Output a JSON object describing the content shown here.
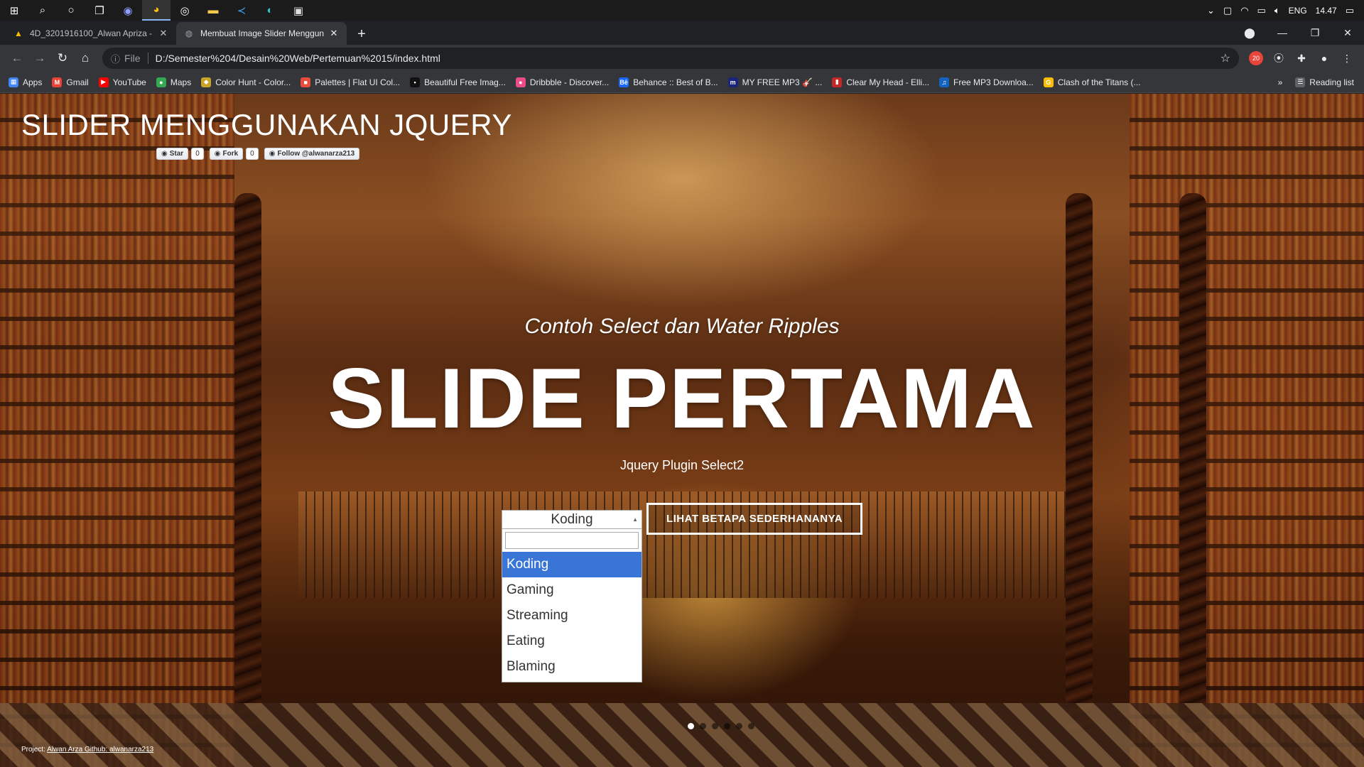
{
  "taskbar": {
    "icons": [
      "windows-icon",
      "search-icon",
      "cortana-icon",
      "task-view-icon",
      "discord-icon",
      "chrome-icon",
      "github-desktop-icon",
      "file-explorer-icon",
      "vscode-icon",
      "edge-icon",
      "photos-icon"
    ],
    "language": "ENG",
    "time": "14.47"
  },
  "tabs": [
    {
      "title": "4D_3201916100_Alwan Apriza - G",
      "icon": "google-drive-icon",
      "active": false
    },
    {
      "title": "Membuat Image Slider Menggun",
      "icon": "globe-icon",
      "active": true
    }
  ],
  "toolbar": {
    "scheme": "File",
    "url": "D:/Semester%204/Desain%20Web/Pertemuan%2015/index.html",
    "ext_badge": "20"
  },
  "bookmarks": [
    {
      "label": "Apps",
      "color": "#4285f4",
      "glyph": "▦"
    },
    {
      "label": "Gmail",
      "color": "#ea4335",
      "glyph": "M"
    },
    {
      "label": "YouTube",
      "color": "#ff0000",
      "glyph": "▶"
    },
    {
      "label": "Maps",
      "color": "#34a853",
      "glyph": "●"
    },
    {
      "label": "Color Hunt - Color...",
      "color": "#c9a227",
      "glyph": "◆"
    },
    {
      "label": "Palettes | Flat UI Col...",
      "color": "#e74c3c",
      "glyph": "■"
    },
    {
      "label": "Beautiful Free Imag...",
      "color": "#111111",
      "glyph": "▪"
    },
    {
      "label": "Dribbble - Discover...",
      "color": "#ea4c89",
      "glyph": "●"
    },
    {
      "label": "Behance :: Best of B...",
      "color": "#1769ff",
      "glyph": "Bē"
    },
    {
      "label": "MY FREE MP3 🎸 ...",
      "color": "#1a237e",
      "glyph": "m"
    },
    {
      "label": "Clear My Head - Elli...",
      "color": "#c62828",
      "glyph": "▮"
    },
    {
      "label": "Free MP3 Downloa...",
      "color": "#1565c0",
      "glyph": "♫"
    },
    {
      "label": "Clash of the Titans (...",
      "color": "#fbbc05",
      "glyph": "G"
    }
  ],
  "bookmarks_more": "»",
  "reading_list": "Reading list",
  "page": {
    "site_title": "SLIDER MENGGUNAKAN JQUERY",
    "github": [
      {
        "label": "Star",
        "count": "0"
      },
      {
        "label": "Fork",
        "count": "0"
      },
      {
        "label": "Follow @alwanarza213",
        "count": ""
      }
    ],
    "subtitle": "Contoh Select dan Water Ripples",
    "headline": "SLIDE PERTAMA",
    "caption": "Jquery Plugin Select2",
    "select": {
      "selected": "Koding",
      "search_value": "",
      "options": [
        "Koding",
        "Gaming",
        "Streaming",
        "Eating",
        "Blaming"
      ],
      "highlighted": "Koding"
    },
    "cta": "LIHAT BETAPA SEDERHANANYA",
    "slides_total": 6,
    "slide_active": 1,
    "footer_prefix": "Project:",
    "footer_link": "Alwan Arza Github: alwanarza213"
  }
}
